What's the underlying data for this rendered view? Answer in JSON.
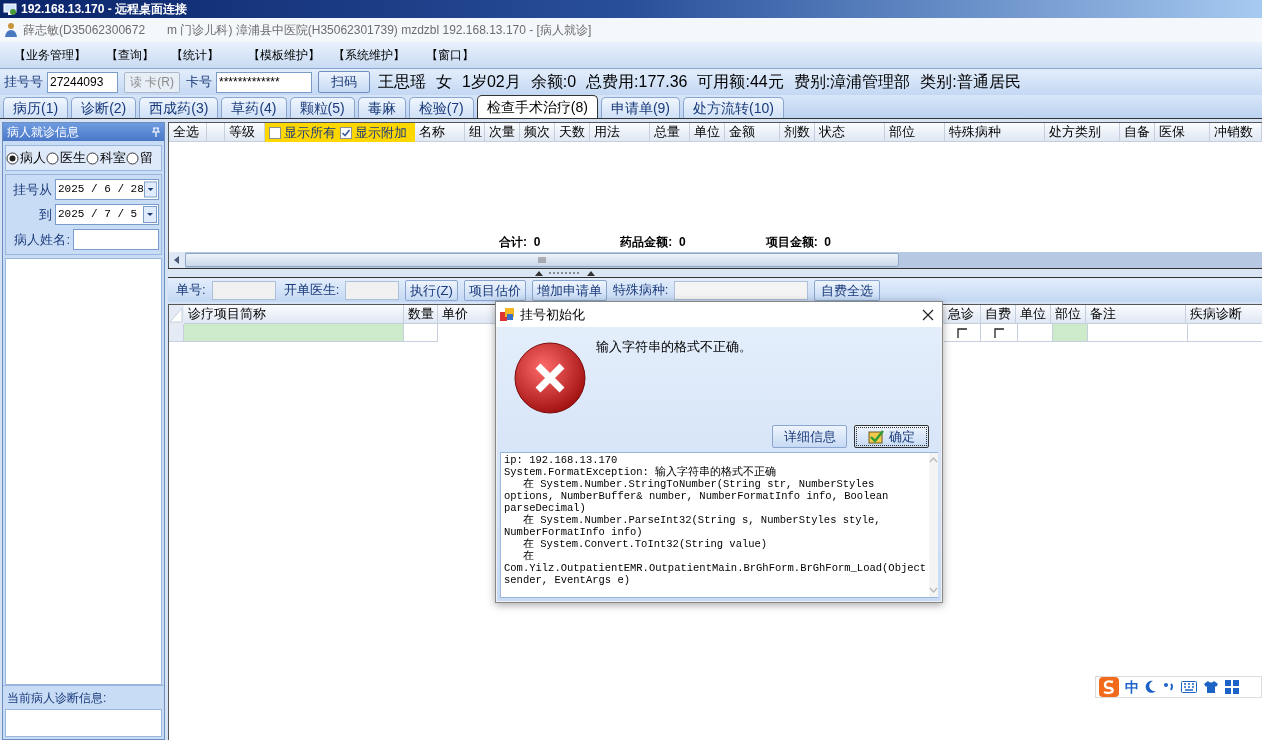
{
  "remote_title": "192.168.13.170 - 远程桌面连接",
  "app_title": [
    "薛志敏(D35062300672",
    "m 门诊儿科) 漳浦县中医院(H35062301739) mzdzbl 192.168.13.170 - [病人就诊]"
  ],
  "menu": [
    "【业务管理】",
    "【查询】",
    "【统计】",
    "【模板维护】",
    "【系统维护】",
    "【窗口】"
  ],
  "patient_bar": {
    "reg_label": "挂号号",
    "reg_value": "27244093",
    "read_card": {
      "label": "读 卡(R)",
      "disabled": true
    },
    "card_label": "卡号",
    "card_value": "*************",
    "scan_button": "扫码",
    "info": [
      "王思瑶",
      "女",
      "1岁02月",
      "余额:0",
      "总费用:177.36",
      "可用额:44元",
      "费别:漳浦管理部",
      "类别:普通居民"
    ]
  },
  "tabs": [
    {
      "label": "病历(1)",
      "selected": false
    },
    {
      "label": "诊断(2)",
      "selected": false
    },
    {
      "label": "西成药(3)",
      "selected": false
    },
    {
      "label": "草药(4)",
      "selected": false
    },
    {
      "label": "颗粒(5)",
      "selected": false
    },
    {
      "label": "毒麻",
      "selected": false
    },
    {
      "label": "检验(7)",
      "selected": false
    },
    {
      "label": "检查手术治疗(8)",
      "selected": true
    },
    {
      "label": "申请单(9)",
      "selected": false
    },
    {
      "label": "处方流转(10)",
      "selected": false
    }
  ],
  "left_panel": {
    "title": "病人就诊信息",
    "radios": [
      {
        "label": "病人",
        "selected": true
      },
      {
        "label": "医生",
        "selected": false
      },
      {
        "label": "科室",
        "selected": false
      },
      {
        "label": "留",
        "selected": false
      }
    ],
    "date_from_label": "挂号从",
    "date_from": "2025 / 6 / 28",
    "date_to_label": "到",
    "date_to": "2025 / 7 / 5",
    "name_label": "病人姓名:",
    "footer": "当前病人诊断信息:"
  },
  "order_grid": {
    "columns_left": [
      "全选",
      "等级"
    ],
    "show_all": {
      "label": "显示所有",
      "checked": false
    },
    "show_extra": {
      "label": "显示附加",
      "checked": true
    },
    "columns_right": [
      "名称",
      "组",
      "次量",
      "频次",
      "天数",
      "用法",
      "总量",
      "单位",
      "金额",
      "剂数",
      "状态",
      "部位",
      "特殊病种",
      "处方类别",
      "自备",
      "医保",
      "冲销数"
    ],
    "totals": [
      "合计:  0",
      "药品金额:  0",
      "项目金额:  0"
    ]
  },
  "item_toolbar": {
    "order_no_label": "单号:",
    "doctor_label": "开单医生:",
    "buttons": [
      "执行(Z)",
      "项目估价",
      "增加申请单"
    ],
    "special_label": "特殊病种:",
    "select_self_pay": "自费全选"
  },
  "item_grid": {
    "columns_left": [
      "诊疗项目简称",
      "数量",
      "单价"
    ],
    "columns_right": [
      "急诊",
      "自费",
      "单位",
      "部位",
      "备注",
      "疾病诊断"
    ],
    "row": {
      "urgent": false,
      "self_pay": false
    }
  },
  "dialog": {
    "title": "挂号初始化",
    "message": "输入字符串的格式不正确。",
    "buttons": [
      {
        "label": "详细信息",
        "default": false
      },
      {
        "label": "确定",
        "default": true
      }
    ],
    "details": [
      "ip: 192.168.13.170",
      "System.FormatException: 输入字符串的格式不正确",
      "在 System.Number.StringToNumber(String str, NumberStyles options, NumberBuffer& number, NumberFormatInfo info, Boolean parseDecimal)",
      "在 System.Number.ParseInt32(String s, NumberStyles style, NumberFormatInfo info)",
      "在 System.Convert.ToInt32(String value)",
      "在 Com.Yilz.OutpatientEMR.OutpatientMain.BrGhForm.BrGhForm_Load(Object sender, EventArgs e)"
    ]
  },
  "ime": {
    "label": "中"
  }
}
